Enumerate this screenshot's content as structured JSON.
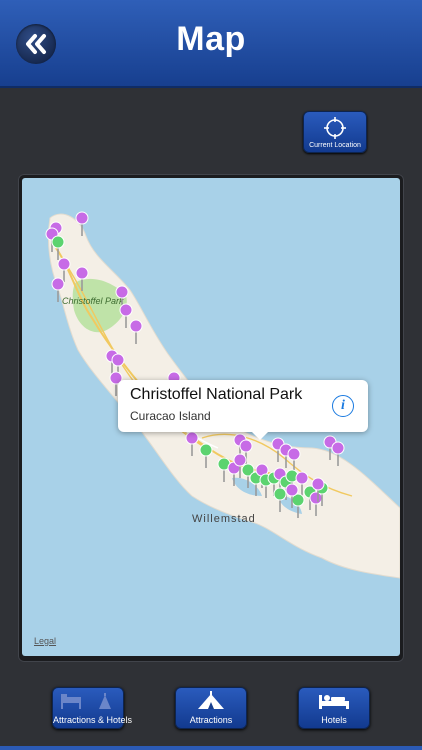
{
  "header": {
    "title": "Map",
    "back_icon": "double-chevron-left-icon"
  },
  "location_button": {
    "label": "Current Location",
    "icon": "crosshair-icon"
  },
  "map": {
    "legal_label": "Legal",
    "place_labels": {
      "park": "Christoffel Park",
      "city": "Willemstad"
    },
    "callout": {
      "title": "Christoffel National Park",
      "subtitle": "Curacao Island",
      "info_icon": "info-icon"
    },
    "pin_colors": {
      "attraction": "#c76be6",
      "hotel": "#5cd36f"
    }
  },
  "tabs": [
    {
      "label": "Attractions & Hotels",
      "icon": "bed-and-tent-icon"
    },
    {
      "label": "Attractions",
      "icon": "tent-icon"
    },
    {
      "label": "Hotels",
      "icon": "bed-icon"
    }
  ]
}
